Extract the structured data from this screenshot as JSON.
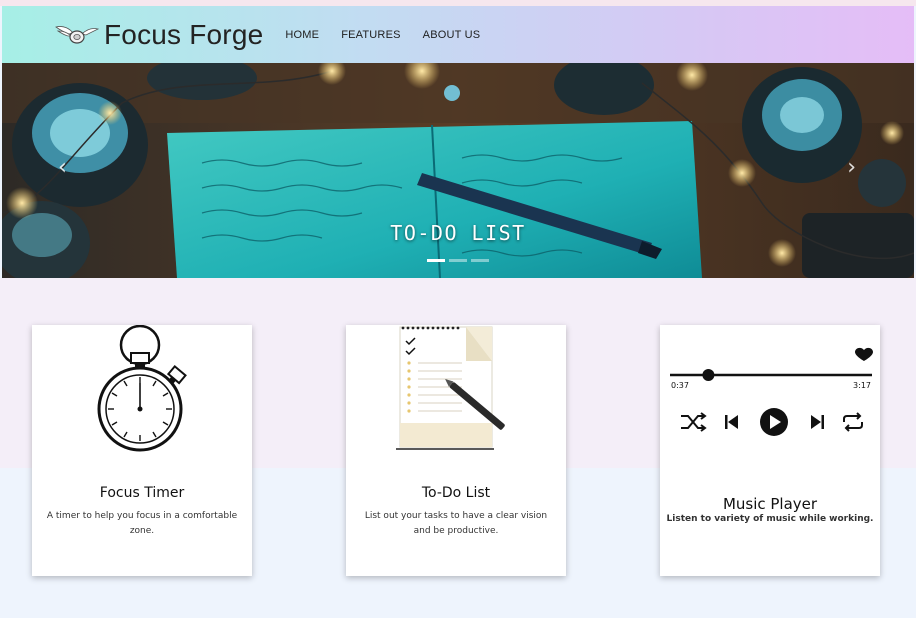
{
  "brand": {
    "name": "Focus Forge",
    "logo_icon": "winged-disc-icon"
  },
  "nav": {
    "items": [
      {
        "label": "HOME"
      },
      {
        "label": "FEATURES"
      },
      {
        "label": "ABOUT US"
      }
    ]
  },
  "hero": {
    "caption": "TO-DO LIST",
    "slide_count": 3,
    "active_slide": 1,
    "prev_icon": "chevron-left-icon",
    "next_icon": "chevron-right-icon"
  },
  "cards": [
    {
      "title": "Focus Timer",
      "description": "A timer to help you focus in a comfortable zone.",
      "icon": "stopwatch-icon"
    },
    {
      "title": "To-Do List",
      "description": "List out your tasks to have a clear vision and be productive.",
      "icon": "notepad-checklist-icon"
    },
    {
      "title": "Music Player",
      "description": "Listen to variety of music while working.",
      "icon": "music-player-icon",
      "player": {
        "elapsed": "0:37",
        "duration": "3:17",
        "progress": 0.19
      }
    }
  ],
  "colors": {
    "nav_gradient_start": "#a6efe6",
    "nav_gradient_end": "#e5bdf7",
    "page_background": "#eef4fd"
  }
}
